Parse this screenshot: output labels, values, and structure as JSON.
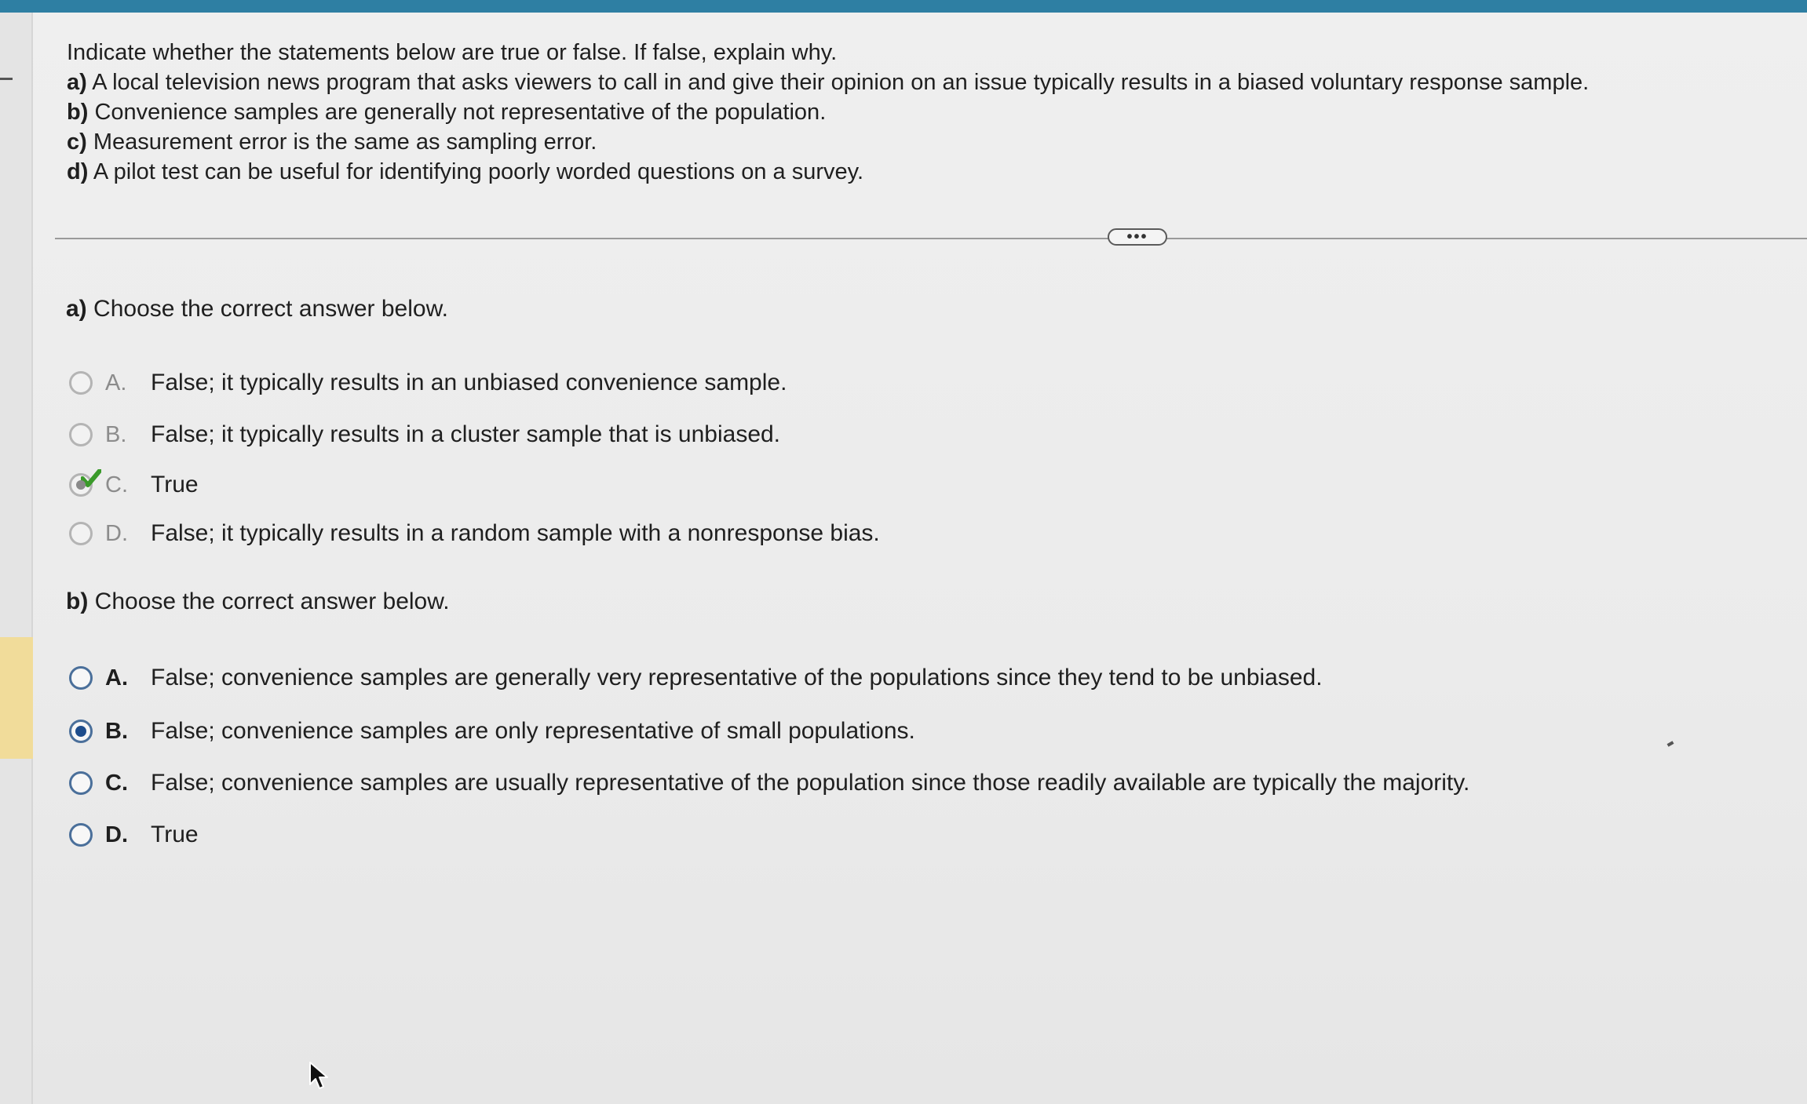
{
  "question": {
    "intro": "Indicate whether the statements below are true or false. If false, explain why.",
    "statements": [
      {
        "letter": "a)",
        "text": "A local television news program that asks viewers to call in and give their opinion on an issue typically results in a biased voluntary response sample."
      },
      {
        "letter": "b)",
        "text": "Convenience samples are generally not representative of the population."
      },
      {
        "letter": "c)",
        "text": "Measurement error is the same as sampling error."
      },
      {
        "letter": "d)",
        "text": "A pilot test can be useful for identifying poorly worded questions on a survey."
      }
    ]
  },
  "more_button": {
    "label": "•••"
  },
  "part_a": {
    "letter": "a)",
    "heading": "Choose the correct answer below.",
    "options": [
      {
        "letter": "A.",
        "text": "False; it typically results in an unbiased convenience sample.",
        "state": "unselected"
      },
      {
        "letter": "B.",
        "text": "False; it typically results in a cluster sample that is unbiased.",
        "state": "unselected"
      },
      {
        "letter": "C.",
        "text": "True",
        "state": "selected-correct"
      },
      {
        "letter": "D.",
        "text": "False; it typically results in a random sample with a nonresponse bias.",
        "state": "unselected"
      }
    ]
  },
  "part_b": {
    "letter": "b)",
    "heading": "Choose the correct answer below.",
    "options": [
      {
        "letter": "A.",
        "text": "False; convenience samples are generally very representative of the populations since they tend to be unbiased.",
        "state": "unselected"
      },
      {
        "letter": "B.",
        "text": "False; convenience samples are only representative of small populations.",
        "state": "selected"
      },
      {
        "letter": "C.",
        "text": "False; convenience samples are usually representative of the population since those readily available are typically the majority.",
        "state": "unselected"
      },
      {
        "letter": "D.",
        "text": "True",
        "state": "unselected"
      }
    ]
  },
  "colors": {
    "top_bar": "#2e7fa3",
    "radio_border": "#4a6f9a",
    "radio_selected": "#1e4d8c",
    "correct_check": "#3a9a2a",
    "gutter_highlight": "#f1dc9a"
  },
  "icons": {
    "correct": "check-icon",
    "pointer": "cursor-icon"
  }
}
